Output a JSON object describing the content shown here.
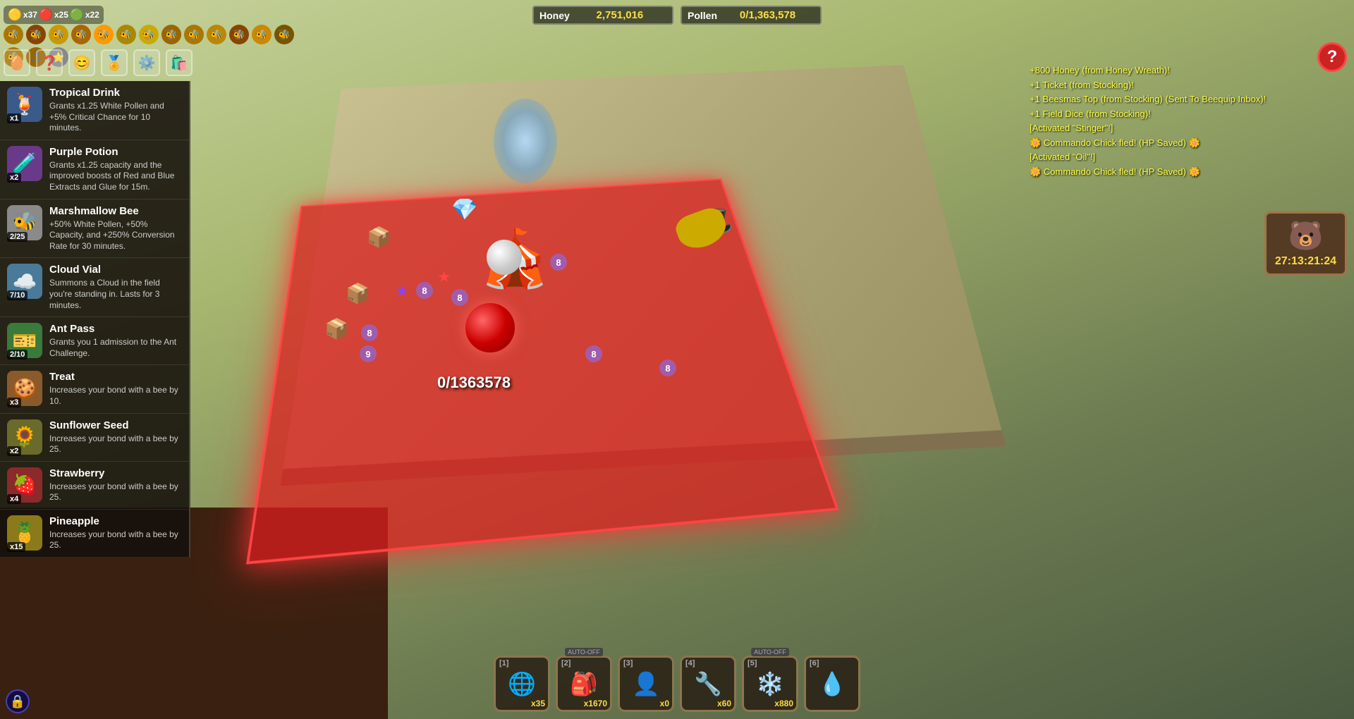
{
  "resources": {
    "honey_label": "Honey",
    "honey_value": "2,751,016",
    "pollen_label": "Pollen",
    "pollen_value": "0/1,363,578"
  },
  "top_counters": {
    "count1": "x37",
    "count2": "x25",
    "count3": "x22"
  },
  "inventory": {
    "items": [
      {
        "name": "Tropical Drink",
        "desc": "Grants x1.25 White Pollen and +5% Critical Chance for 10 minutes.",
        "icon": "🍹",
        "count": "x1",
        "bg": "#3a5a8a"
      },
      {
        "name": "Purple Potion",
        "desc": "Grants x1.25 capacity and the improved boosts of Red and Blue Extracts and Glue for 15m.",
        "icon": "🧪",
        "count": "x2",
        "bg": "#6a3a8a"
      },
      {
        "name": "Marshmallow Bee",
        "desc": "+50% White Pollen, +50% Capacity, and +250% Conversion Rate for 30 minutes.",
        "icon": "🐝",
        "count": "2/25",
        "bg": "#8a8a8a"
      },
      {
        "name": "Cloud Vial",
        "desc": "Summons a Cloud in the field you're standing in. Lasts for 3 minutes.",
        "icon": "☁️",
        "count": "7/10",
        "bg": "#4a7a9a"
      },
      {
        "name": "Ant Pass",
        "desc": "Grants you 1 admission to the Ant Challenge.",
        "icon": "🎫",
        "count": "2/10",
        "bg": "#3a7a3a"
      },
      {
        "name": "Treat",
        "desc": "Increases your bond with a bee by 10.",
        "icon": "🍪",
        "count": "x3",
        "bg": "#8a5a2a"
      },
      {
        "name": "Sunflower Seed",
        "desc": "Increases your bond with a bee by 25.",
        "icon": "🌻",
        "count": "x2",
        "bg": "#6a6a2a"
      },
      {
        "name": "Strawberry",
        "desc": "Increases your bond with a bee by 25.",
        "icon": "🍓",
        "count": "x4",
        "bg": "#8a2a2a"
      },
      {
        "name": "Pineapple",
        "desc": "Increases your bond with a bee by 25.",
        "icon": "🍍",
        "count": "x15",
        "bg": "#8a7a1a"
      }
    ]
  },
  "event_log": {
    "entries": [
      "+800 Honey (from Honey Wreath)!",
      "+1 Ticket (from Stocking)!",
      "+1 Beesmas Top (from Stocking) (Sent To Beequip Inbox)!",
      "+1 Field Dice (from Stocking)!",
      "[Activated \"Stinger\"!]",
      "🌼 Commando Chick fled! (HP Saved) 🌼",
      "[Activated \"Oil\"!]",
      "🌼 Commando Chick fled! (HP Saved) 🌼"
    ]
  },
  "timer": {
    "icon": "🐻",
    "value": "27:13:21:24"
  },
  "help_btn": "?",
  "world_pollen": "0/1363578",
  "action_bar": {
    "slots": [
      {
        "num": "1",
        "icon": "🌐",
        "count": "x35",
        "auto": false
      },
      {
        "num": "2",
        "icon": "🎒",
        "count": "x1670",
        "auto": true
      },
      {
        "num": "3",
        "icon": "👤",
        "count": "x0",
        "auto": false
      },
      {
        "num": "4",
        "icon": "🔧",
        "count": "x60",
        "auto": false
      },
      {
        "num": "5",
        "icon": "❄️",
        "count": "x880",
        "auto": true
      },
      {
        "num": "6",
        "icon": "💧",
        "count": "",
        "auto": false
      }
    ]
  },
  "menu_icons": {
    "items": [
      {
        "name": "egg-icon",
        "symbol": "🥚"
      },
      {
        "name": "question-icon",
        "symbol": "❓"
      },
      {
        "name": "face-icon",
        "symbol": "😊"
      },
      {
        "name": "badge-icon",
        "symbol": "🏅"
      },
      {
        "name": "gear-icon",
        "symbol": "⚙️"
      },
      {
        "name": "bag-icon",
        "symbol": "🛍️"
      }
    ]
  }
}
